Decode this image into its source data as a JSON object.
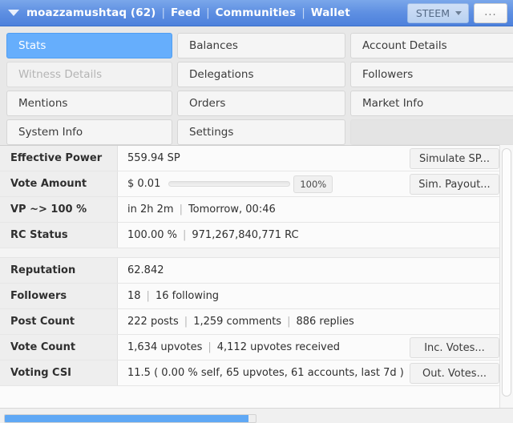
{
  "header": {
    "caret_icon": "chevron-down-icon",
    "username": "moazzamushtaq (62)",
    "sep": "|",
    "links": [
      "Feed",
      "Communities",
      "Wallet"
    ],
    "token_label": "STEEM",
    "token_caret_icon": "chevron-down-icon",
    "more_label": "...",
    "bg_color": "#5e8fe2"
  },
  "tabs": [
    {
      "label": "Stats",
      "state": "active"
    },
    {
      "label": "Balances",
      "state": "normal"
    },
    {
      "label": "Account Details",
      "state": "normal"
    },
    {
      "label": "Witness Details",
      "state": "disabled"
    },
    {
      "label": "Delegations",
      "state": "normal"
    },
    {
      "label": "Followers",
      "state": "normal"
    },
    {
      "label": "Mentions",
      "state": "normal"
    },
    {
      "label": "Orders",
      "state": "normal"
    },
    {
      "label": "Market Info",
      "state": "normal"
    },
    {
      "label": "System Info",
      "state": "normal"
    },
    {
      "label": "Settings",
      "state": "normal"
    },
    {
      "label": "",
      "state": "empty"
    }
  ],
  "active_tab_color": "#66aefc",
  "stats": {
    "group_one": [
      {
        "label": "Effective Power",
        "value": "559.94 SP",
        "button": "Simulate SP..."
      },
      {
        "label": "Vote Amount",
        "value": "$ 0.01",
        "slider_percent_label": "100%",
        "slider_percent": 100,
        "button": "Sim. Payout..."
      },
      {
        "label": "VP ~> 100 %",
        "parts": [
          "in 2h 2m",
          "Tomorrow, 00:46"
        ]
      },
      {
        "label": "RC Status",
        "parts": [
          "100.00 %",
          "971,267,840,771 RC"
        ]
      }
    ],
    "group_two": [
      {
        "label": "Reputation",
        "value": "62.842"
      },
      {
        "label": "Followers",
        "parts": [
          "18",
          "16 following"
        ]
      },
      {
        "label": "Post Count",
        "parts": [
          "222 posts",
          "1,259 comments",
          "886 replies"
        ]
      },
      {
        "label": "Vote Count",
        "parts": [
          "1,634 upvotes",
          "4,112 upvotes received"
        ],
        "button": "Inc. Votes..."
      },
      {
        "label": "Voting CSI",
        "value": "11.5 ( 0.00 % self, 65 upvotes, 61 accounts, last 7d )",
        "button": "Out. Votes..."
      }
    ]
  },
  "footer": {
    "progress_percent": 97,
    "progress_color": "#5fa8f5"
  }
}
